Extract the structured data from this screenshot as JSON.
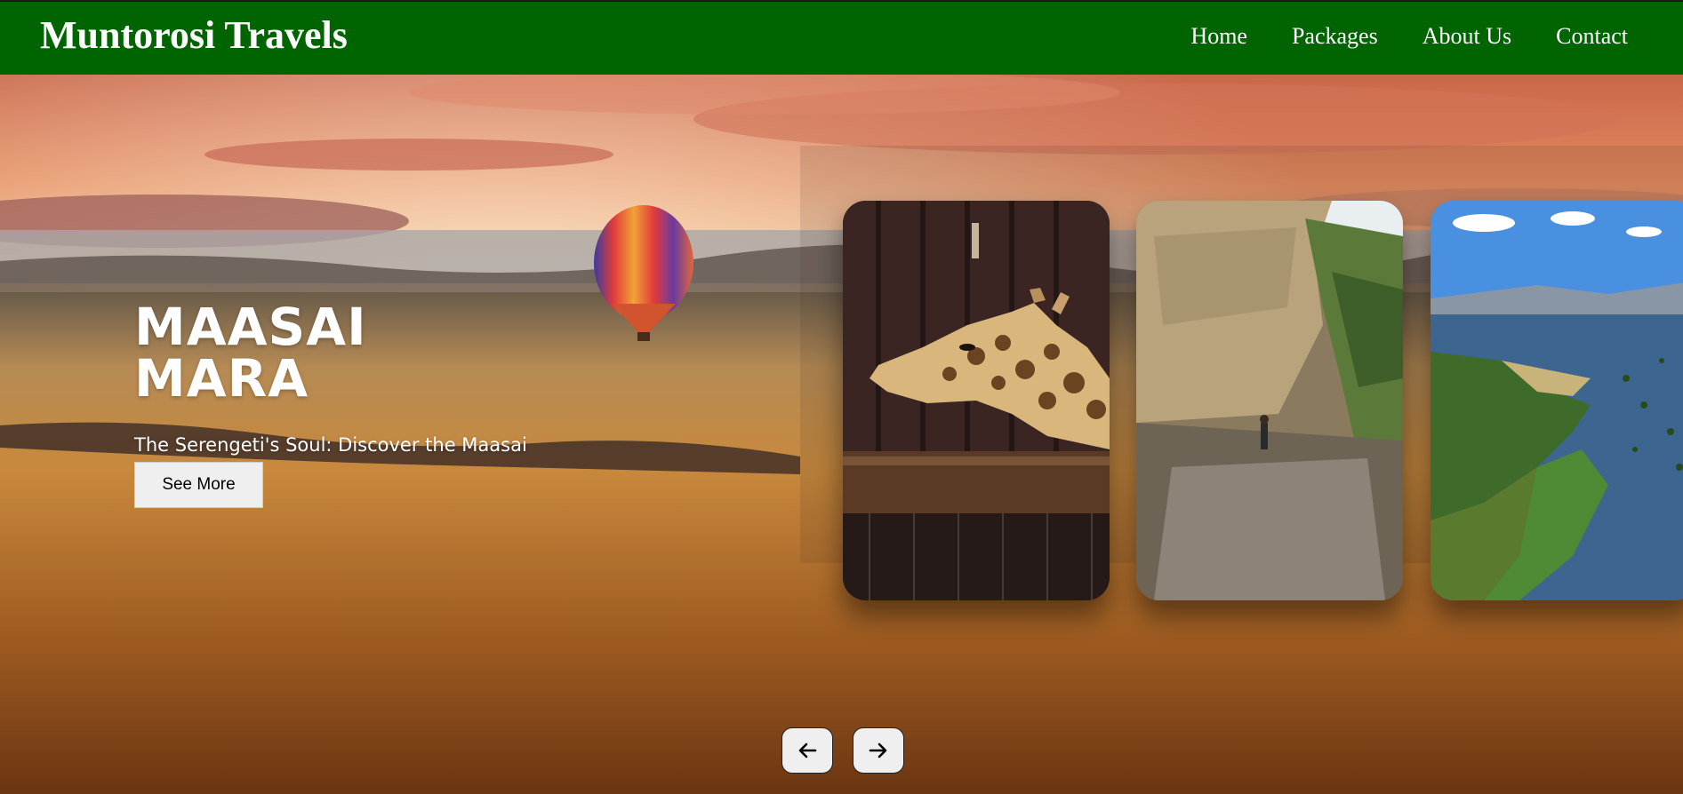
{
  "brand": "Muntorosi Travels",
  "nav": {
    "home": "Home",
    "packages": "Packages",
    "about": "About Us",
    "contact": "Contact"
  },
  "hero": {
    "title": "MAASAI MARA",
    "description": "The Serengeti's Soul: Discover the Maasai Mara.",
    "button_label": "See More"
  },
  "thumbnails": [
    "giraffe",
    "gorge",
    "lake"
  ],
  "colors": {
    "navbar": "#006400",
    "button_bg": "#efefef"
  },
  "icons": {
    "prev": "arrow-left-icon",
    "next": "arrow-right-icon"
  }
}
